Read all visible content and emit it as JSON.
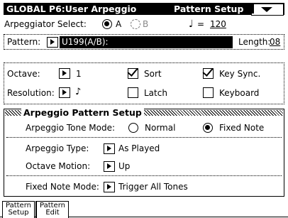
{
  "header": {
    "title": "GLOBAL P6:User Arpeggio",
    "page": "Pattern Setup"
  },
  "arp_select": {
    "label": "Arpeggiator Select:",
    "option_a": "A",
    "option_b": "B",
    "selected": "A",
    "tempo_value": "120"
  },
  "pattern": {
    "label": "Pattern:",
    "value": "U199(A/B):",
    "length_label": "Length:",
    "length_value": "08"
  },
  "settings": {
    "octave_label": "Octave:",
    "octave_value": "1",
    "resolution_label": "Resolution:",
    "resolution_value": "♪",
    "sort_label": "Sort",
    "sort_checked": true,
    "key_sync_label": "Key Sync.",
    "key_sync_checked": true,
    "latch_label": "Latch",
    "latch_checked": false,
    "keyboard_label": "Keyboard",
    "keyboard_checked": false
  },
  "arp_setup": {
    "heading": "Arpeggio Pattern Setup",
    "tone_mode_label": "Arpeggio Tone Mode:",
    "tone_mode_normal": "Normal",
    "tone_mode_fixed": "Fixed Note",
    "tone_mode_selected": "Fixed Note",
    "type_label": "Arpeggio Type:",
    "type_value": "As Played",
    "octave_motion_label": "Octave Motion:",
    "octave_motion_value": "Up",
    "fixed_mode_label": "Fixed Note Mode:",
    "fixed_mode_value": "Trigger All Tones"
  },
  "tabs": [
    {
      "line1": "Pattern",
      "line2": "Setup"
    },
    {
      "line1": "Pattern",
      "line2": "Edit"
    }
  ]
}
